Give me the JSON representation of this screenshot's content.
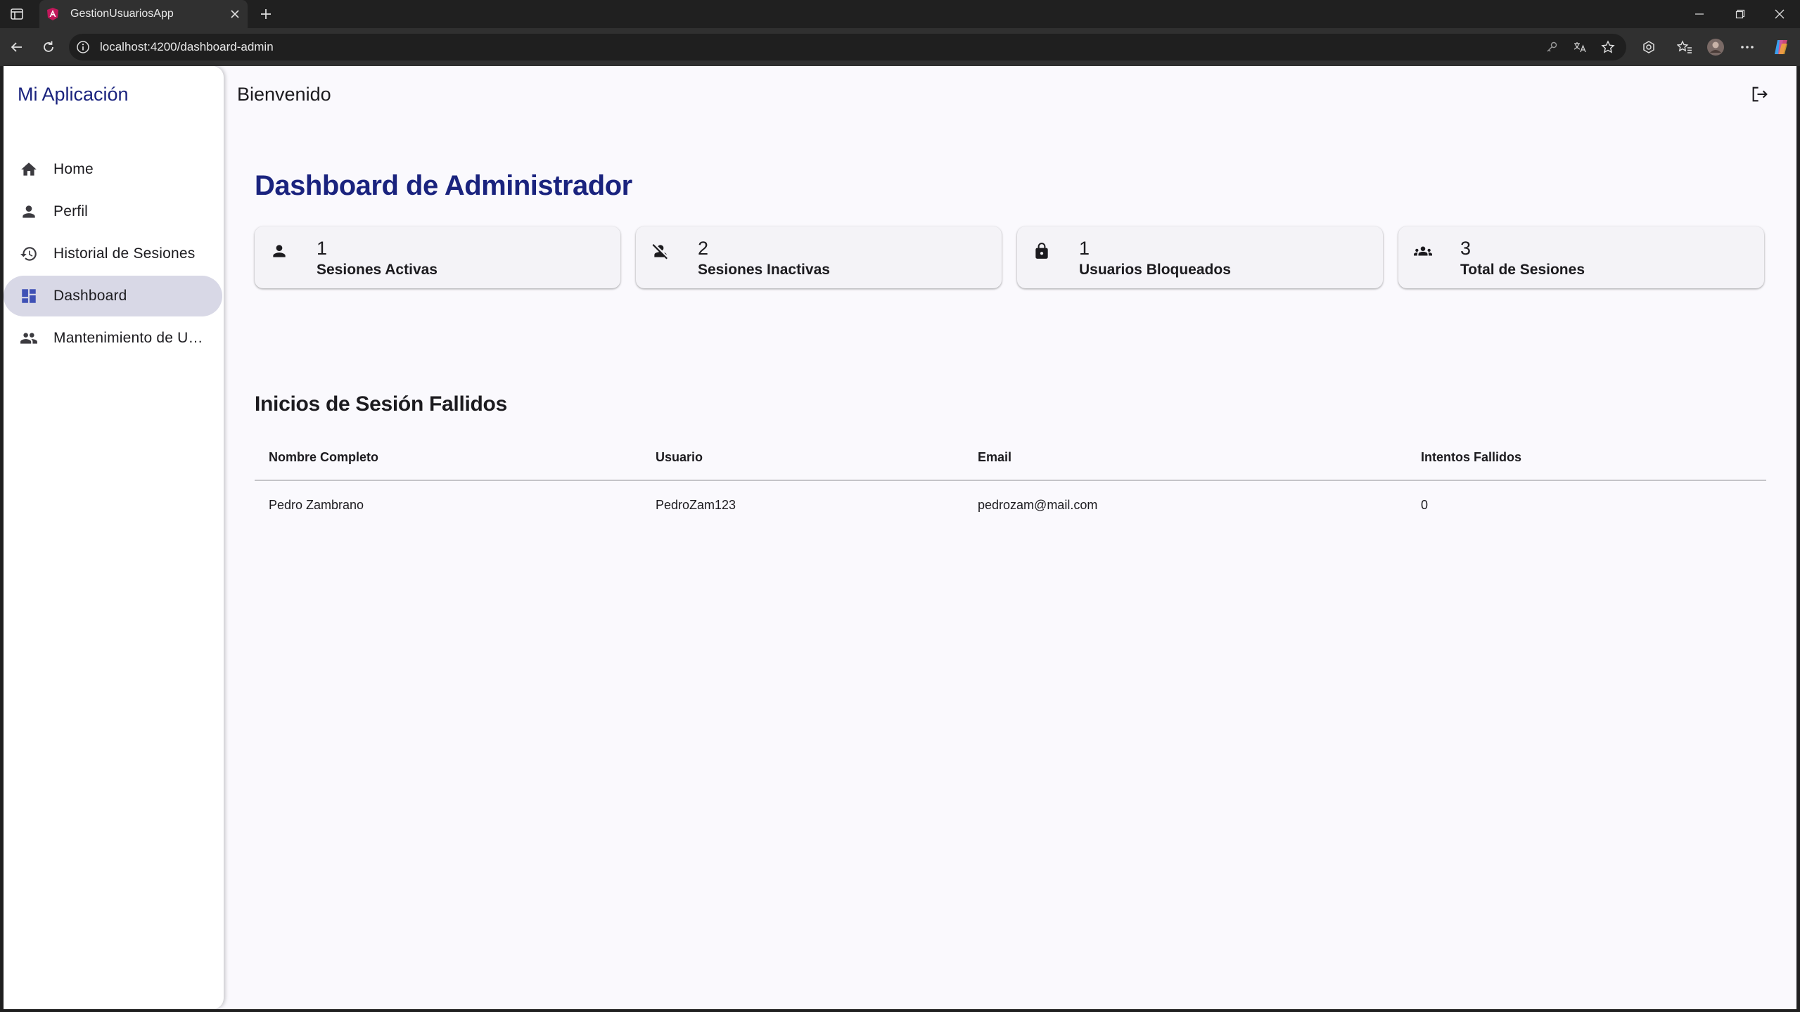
{
  "browser": {
    "tab_title": "GestionUsuariosApp",
    "url": "localhost:4200/dashboard-admin"
  },
  "app": {
    "title": "Mi Aplicación",
    "header_title": "Bienvenido",
    "colors": {
      "primary": "#1a237e",
      "active_item": "#d8d8e6",
      "background": "#faf9fd"
    }
  },
  "sidebar": {
    "items": [
      {
        "label": "Home",
        "icon": "home-icon",
        "active": false
      },
      {
        "label": "Perfil",
        "icon": "person-icon",
        "active": false
      },
      {
        "label": "Historial de Sesiones",
        "icon": "history-icon",
        "active": false
      },
      {
        "label": "Dashboard",
        "icon": "dashboard-icon",
        "active": true
      },
      {
        "label": "Mantenimiento de Usuarios",
        "icon": "group-icon",
        "active": false
      }
    ]
  },
  "dashboard": {
    "title": "Dashboard de Administrador",
    "cards": [
      {
        "value": "1",
        "label": "Sesiones Activas",
        "icon": "person-icon"
      },
      {
        "value": "2",
        "label": "Sesiones Inactivas",
        "icon": "person-off-icon"
      },
      {
        "value": "1",
        "label": "Usuarios Bloqueados",
        "icon": "lock-icon"
      },
      {
        "value": "3",
        "label": "Total de Sesiones",
        "icon": "groups-icon"
      }
    ]
  },
  "failed_logins": {
    "title": "Inicios de Sesión Fallidos",
    "columns": [
      "Nombre Completo",
      "Usuario",
      "Email",
      "Intentos Fallidos"
    ],
    "rows": [
      [
        "Pedro Zambrano",
        "PedroZam123",
        "pedrozam@mail.com",
        "0"
      ]
    ]
  }
}
